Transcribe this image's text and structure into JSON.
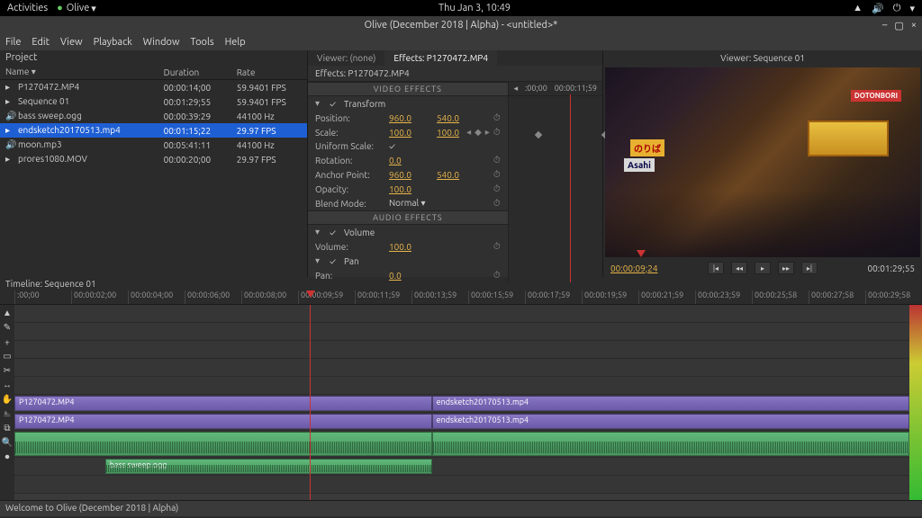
{
  "topbar": {
    "activities": "Activities",
    "app": "Olive",
    "clock": "Thu Jan  3, 10:49"
  },
  "window": {
    "title": "Olive (December 2018 | Alpha) - <untitled>*"
  },
  "menubar": [
    "File",
    "Edit",
    "View",
    "Playback",
    "Window",
    "Tools",
    "Help"
  ],
  "project": {
    "title": "Project",
    "columns": [
      "Name",
      "Duration",
      "Rate"
    ],
    "rows": [
      {
        "icon": "▸",
        "name": "P1270472.MP4",
        "duration": "00:00:14;00",
        "rate": "59.9401 FPS",
        "selected": false
      },
      {
        "icon": "▸",
        "name": "Sequence 01",
        "duration": "00:01:29;55",
        "rate": "59.9401 FPS",
        "selected": false
      },
      {
        "icon": "🔊",
        "name": "bass sweep.ogg",
        "duration": "00:00:39:29",
        "rate": "44100 Hz",
        "selected": false
      },
      {
        "icon": "▸",
        "name": "endsketch20170513.mp4",
        "duration": "00:01:15;22",
        "rate": "29.97 FPS",
        "selected": true
      },
      {
        "icon": "🔊",
        "name": "moon.mp3",
        "duration": "00:05:41:11",
        "rate": "44100 Hz",
        "selected": false
      },
      {
        "icon": "▸",
        "name": "prores1080.MOV",
        "duration": "00:00:20;00",
        "rate": "29.97 FPS",
        "selected": false
      }
    ]
  },
  "effects": {
    "tabs": {
      "viewer": "Viewer: (none)",
      "effects": "Effects: P1270472.MP4"
    },
    "subtitle": "Effects: P1270472.MP4",
    "video_hdr": "VIDEO EFFECTS",
    "audio_hdr": "AUDIO EFFECTS",
    "transform": "Transform",
    "volume_sec": "Volume",
    "pan_sec": "Pan",
    "rows": {
      "position": {
        "lbl": "Position:",
        "x": "960.0",
        "y": "540.0"
      },
      "scale": {
        "lbl": "Scale:",
        "x": "100.0",
        "y": "100.0"
      },
      "uniform": {
        "lbl": "Uniform Scale:",
        "chk": "✓"
      },
      "rotation": {
        "lbl": "Rotation:",
        "v": "0.0"
      },
      "anchor": {
        "lbl": "Anchor Point:",
        "x": "960.0",
        "y": "540.0"
      },
      "opacity": {
        "lbl": "Opacity:",
        "v": "100.0"
      },
      "blend": {
        "lbl": "Blend Mode:",
        "v": "Normal"
      },
      "volume": {
        "lbl": "Volume:",
        "v": "100.0"
      },
      "pan": {
        "lbl": "Pan:",
        "v": "0.0"
      }
    },
    "scrub": {
      "start": ":00;00",
      "end": "00:00:11;59"
    }
  },
  "viewer": {
    "title": "Viewer: Sequence 01",
    "tc_in": "00:00:09;24",
    "tc_out": "00:01:29;55",
    "signs": {
      "nori": "のりば",
      "asahi": "Asahi",
      "doton": "DOTONBORI"
    }
  },
  "timeline": {
    "title": "Timeline: Sequence 01",
    "ticks": [
      ":00;00",
      "00:00:02;00",
      "00:00:04;00",
      "00:00:06;00",
      "00:00:08;00",
      "00:00:09;59",
      "00:00:11;59",
      "00:00:13;59",
      "00:00:15;59",
      "00:00:17;59",
      "00:00:19;59",
      "00:00:21;59",
      "00:00:23;59",
      "00:00:25;58",
      "00:00:27;58",
      "00:00:29;58"
    ],
    "clips": {
      "v1a": "P1270472.MP4",
      "v1b": "endsketch20170513.mp4",
      "v2a": "P1270472.MP4",
      "v2b": "endsketch20170513.mp4",
      "a1": "bass sweep.ogg"
    }
  },
  "statusbar": "Welcome to Olive (December 2018 | Alpha)"
}
